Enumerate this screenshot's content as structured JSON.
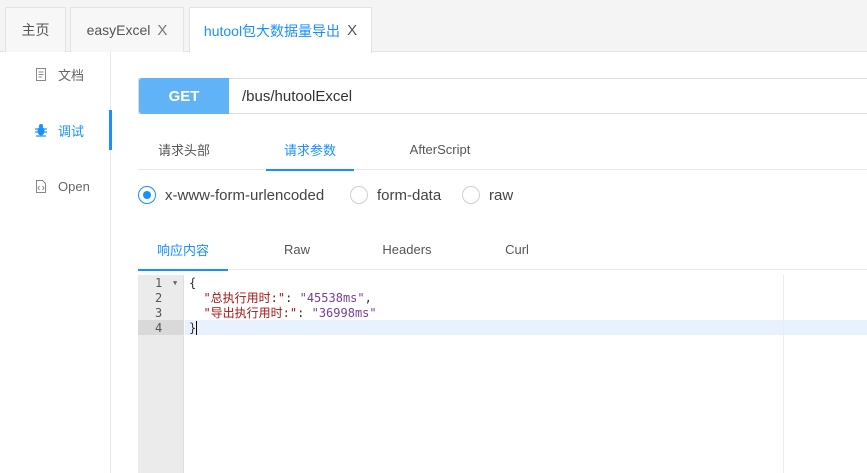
{
  "tabs": [
    {
      "label": "主页",
      "closable": false,
      "active": false
    },
    {
      "label": "easyExcel",
      "closable": true,
      "active": false
    },
    {
      "label": "hutool包大数据量导出",
      "closable": true,
      "active": true
    }
  ],
  "close_glyph": "X",
  "sidebar": {
    "items": [
      {
        "label": "文档",
        "icon": "document-icon",
        "active": false
      },
      {
        "label": "调试",
        "icon": "bug-icon",
        "active": true
      },
      {
        "label": "Open",
        "icon": "file-code-icon",
        "active": false
      }
    ]
  },
  "request": {
    "method": "GET",
    "url": "/bus/hutoolExcel"
  },
  "request_tabs": [
    {
      "label": "请求头部",
      "active": false
    },
    {
      "label": "请求参数",
      "active": true
    },
    {
      "label": "AfterScript",
      "active": false
    }
  ],
  "body_types": [
    {
      "label": "x-www-form-urlencoded",
      "checked": true
    },
    {
      "label": "form-data",
      "checked": false
    },
    {
      "label": "raw",
      "checked": false
    }
  ],
  "response_tabs": [
    {
      "label": "响应内容",
      "active": true
    },
    {
      "label": "Raw",
      "active": false
    },
    {
      "label": "Headers",
      "active": false
    },
    {
      "label": "Curl",
      "active": false
    }
  ],
  "response": {
    "line_numbers": [
      "1",
      "2",
      "3",
      "4"
    ],
    "open_brace": "{",
    "close_brace": "}",
    "entries": [
      {
        "key": "\"总执行用时:\"",
        "colon": ": ",
        "value": "\"45538ms\"",
        "trail": ","
      },
      {
        "key": "\"导出执行用时:\"",
        "colon": ": ",
        "value": "\"36998ms\"",
        "trail": ""
      }
    ]
  },
  "colors": {
    "accent": "#1890ff",
    "method_bg": "#5fb3f6",
    "json_key": "#a31515",
    "json_string": "#7a3e9d"
  }
}
